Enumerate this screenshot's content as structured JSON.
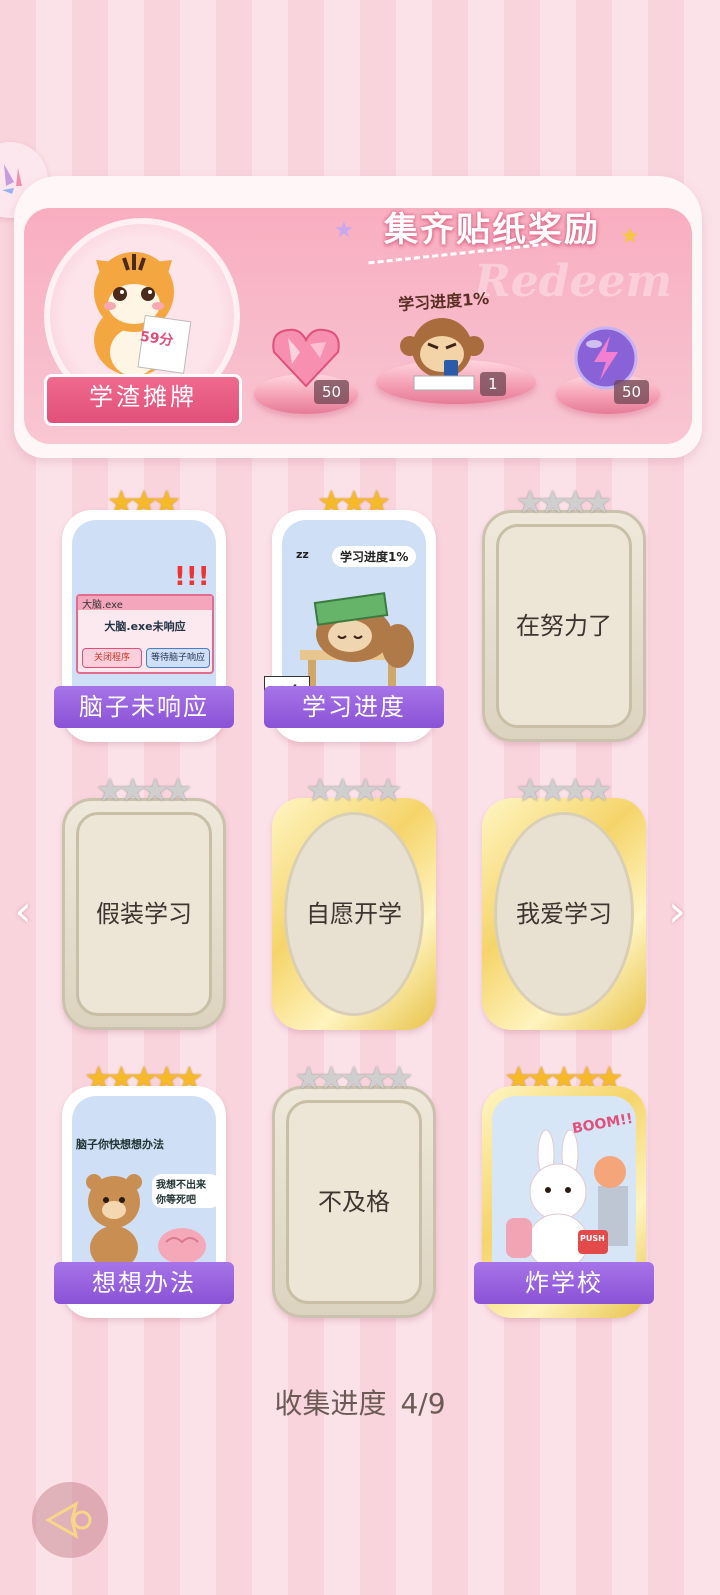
{
  "reward": {
    "title": "集齐贴纸奖励",
    "watermark": "Redeem",
    "player_title": "学渣摊牌",
    "tiger_paper_text": "59分",
    "progress_caption": "学习进度1%",
    "items": [
      {
        "icon": "pink-heart-gem-icon",
        "qty": "50"
      },
      {
        "icon": "monkey-sticker-icon",
        "qty": "1"
      },
      {
        "icon": "purple-energy-orb-icon",
        "qty": "50"
      }
    ]
  },
  "cards": [
    {
      "label": "脑子未响应",
      "stars": 3,
      "max_stars": 3,
      "state": "owned",
      "art_texts": {
        "window_title": "大脑.exe",
        "message": "大脑.exe未响应",
        "btn1": "关闭程序",
        "btn2": "等待脑子响应"
      }
    },
    {
      "label": "学习进度",
      "stars": 3,
      "max_stars": 3,
      "state": "owned",
      "extra_badge": "+4",
      "art_texts": {
        "caption": "学习进度1%",
        "zz": "zz"
      }
    },
    {
      "label": "在努力了",
      "stars": 0,
      "max_stars": 4,
      "state": "locked"
    },
    {
      "label": "假装学习",
      "stars": 0,
      "max_stars": 4,
      "state": "locked"
    },
    {
      "label": "自愿开学",
      "stars": 0,
      "max_stars": 4,
      "state": "locked-gold"
    },
    {
      "label": "我爱学习",
      "stars": 0,
      "max_stars": 4,
      "state": "locked-gold"
    },
    {
      "label": "想想办法",
      "stars": 5,
      "max_stars": 5,
      "state": "owned",
      "art_texts": {
        "caption": "脑子你快想想办法",
        "reply": "我想不出来 你等死吧"
      }
    },
    {
      "label": "不及格",
      "stars": 0,
      "max_stars": 5,
      "state": "locked"
    },
    {
      "label": "炸学校",
      "stars": 5,
      "max_stars": 5,
      "state": "owned",
      "art_texts": {
        "boom": "BOOM!!",
        "push": "PUSH"
      }
    }
  ],
  "collection": {
    "label": "收集进度",
    "value": "4/9"
  },
  "nav": {
    "left_arrow": "‹",
    "right_arrow": "›"
  },
  "colors": {
    "accent_pink": "#f06a8e",
    "label_purple": "#8a52d6",
    "star_gold": "#f6b92a"
  }
}
